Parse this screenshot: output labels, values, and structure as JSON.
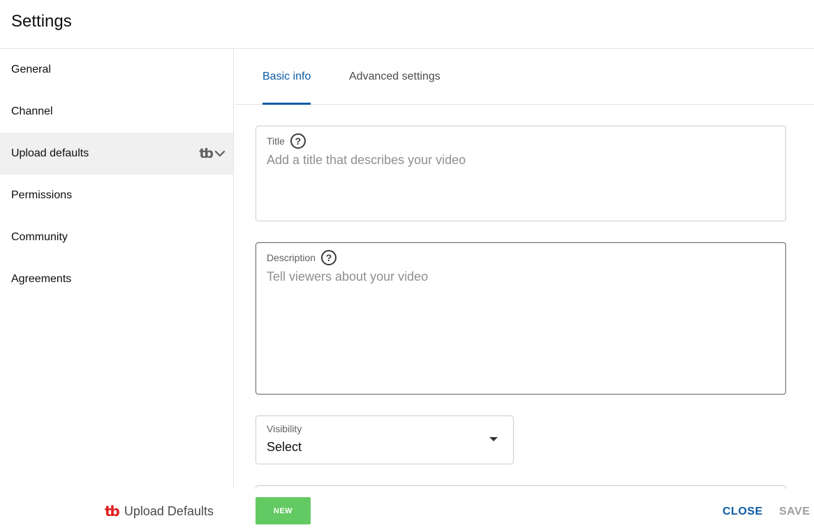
{
  "header": {
    "title": "Settings"
  },
  "sidebar": {
    "items": [
      {
        "label": "General"
      },
      {
        "label": "Channel"
      },
      {
        "label": "Upload defaults"
      },
      {
        "label": "Permissions"
      },
      {
        "label": "Community"
      },
      {
        "label": "Agreements"
      }
    ],
    "tubebuddy_mark": "tb",
    "active_index": 2
  },
  "tabs": [
    {
      "label": "Basic info"
    },
    {
      "label": "Advanced settings"
    }
  ],
  "form": {
    "title": {
      "label": "Title",
      "placeholder": "Add a title that describes your video"
    },
    "description": {
      "label": "Description",
      "placeholder": "Tell viewers about your video"
    },
    "visibility": {
      "label": "Visibility",
      "value": "Select"
    }
  },
  "footer": {
    "brand_mark": "tb",
    "brand_name": "Upload Defaults",
    "new_label": "NEW",
    "close_label": "CLOSE",
    "save_label": "SAVE"
  },
  "colors": {
    "accent": "#0b5ba6",
    "new_button": "#63c963",
    "brand_red": "#e01e1e"
  },
  "icons": [
    "help-icon",
    "chevron-down-icon",
    "caret-down-icon",
    "tubebuddy-logo-icon"
  ]
}
